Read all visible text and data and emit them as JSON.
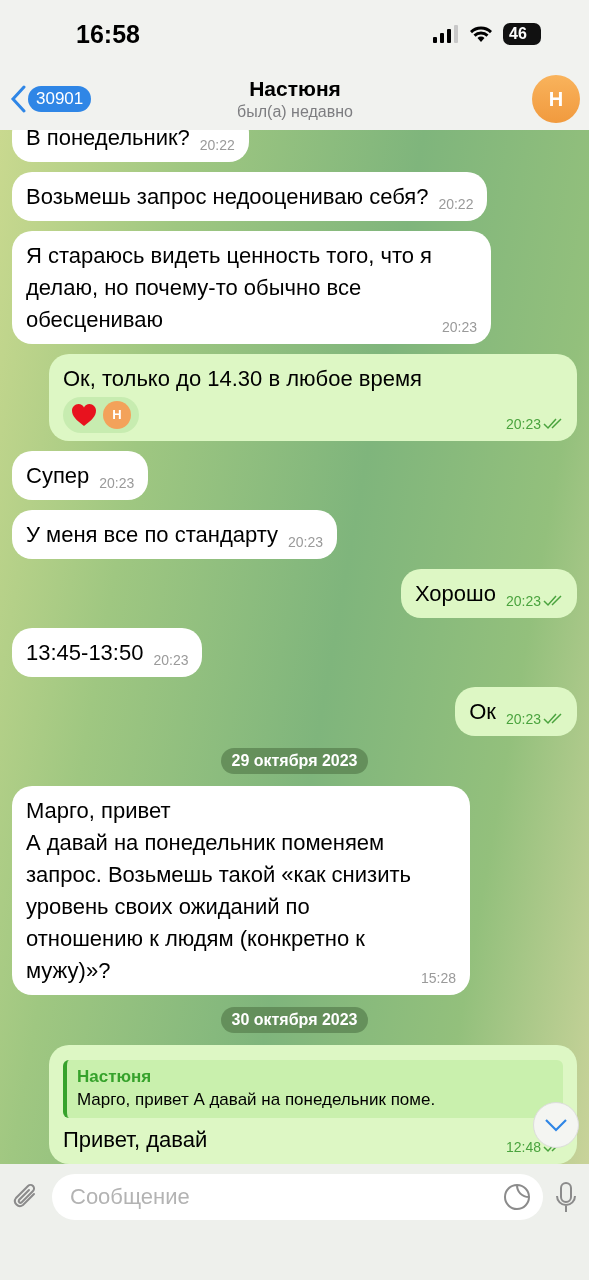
{
  "status_bar": {
    "time": "16:58",
    "battery": "46"
  },
  "header": {
    "back_count": "30901",
    "title": "Настюня",
    "subtitle": "был(а) недавно",
    "avatar": "Н"
  },
  "messages": [
    {
      "kind": "incoming",
      "text": "В понедельник?",
      "time": "20:22"
    },
    {
      "kind": "incoming",
      "text": "Возьмешь запрос недооцениваю себя?",
      "time": "20:22"
    },
    {
      "kind": "incoming",
      "text": "Я стараюсь видеть ценность того, что я\nделаю, но почему-то обычно все\nобесцениваю",
      "time": "20:23"
    },
    {
      "kind": "outgoing",
      "text": "Ок,  только до 14.30 в любое время",
      "time": "20:23",
      "read": true,
      "reaction_avatar": "Н"
    },
    {
      "kind": "incoming",
      "text": "Супер",
      "time": "20:23"
    },
    {
      "kind": "incoming",
      "text": "У меня все по стандарту",
      "time": "20:23"
    },
    {
      "kind": "outgoing",
      "text": "Хорошо",
      "time": "20:23",
      "read": true
    },
    {
      "kind": "incoming",
      "text": "13:45-13:50",
      "time": "20:23"
    },
    {
      "kind": "outgoing",
      "text": "Ок",
      "time": "20:23",
      "read": true
    },
    {
      "kind": "date",
      "text": "29 октября 2023"
    },
    {
      "kind": "incoming",
      "text": "Марго, привет\nА давай на понедельник поменяем\nзапрос. Возьмешь такой «как снизить\nуровень своих ожиданий по\nотношению к людям (конкретно к\nмужу)»?",
      "time": "15:28"
    },
    {
      "kind": "date",
      "text": "30 октября 2023"
    },
    {
      "kind": "outgoing",
      "text": "Привет, давай",
      "time": "12:48",
      "read": true,
      "reply_name": "Настюня",
      "reply_text": "Марго, привет А давай на понедельник поме."
    }
  ],
  "composer": {
    "placeholder": "Сообщение"
  }
}
